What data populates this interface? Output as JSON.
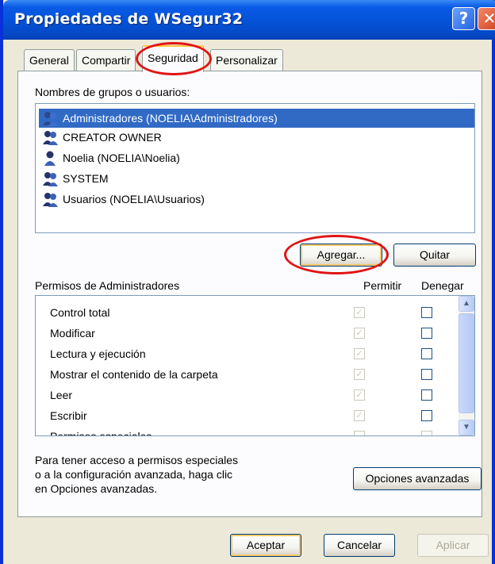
{
  "window": {
    "title": "Propiedades de WSegur32",
    "help_glyph": "?",
    "close_glyph": "✕"
  },
  "tabs": [
    {
      "label": "General"
    },
    {
      "label": "Compartir"
    },
    {
      "label": "Seguridad",
      "active": true
    },
    {
      "label": "Personalizar"
    }
  ],
  "security": {
    "groups_label": "Nombres de grupos o usuarios:",
    "users": [
      {
        "name": "Administradores (NOELIA\\Administradores)",
        "selected": true,
        "icon": "group-icon"
      },
      {
        "name": "CREATOR OWNER",
        "icon": "group-icon"
      },
      {
        "name": "Noelia (NOELIA\\Noelia)",
        "icon": "user-icon"
      },
      {
        "name": "SYSTEM",
        "icon": "group-icon"
      },
      {
        "name": "Usuarios (NOELIA\\Usuarios)",
        "icon": "group-icon"
      }
    ],
    "add_button": "Agregar...",
    "remove_button": "Quitar",
    "permissions_label": "Permisos de Administradores",
    "allow_header": "Permitir",
    "deny_header": "Denegar",
    "permissions": [
      {
        "name": "Control total",
        "allow": true,
        "deny": false
      },
      {
        "name": "Modificar",
        "allow": true,
        "deny": false
      },
      {
        "name": "Lectura y ejecución",
        "allow": true,
        "deny": false
      },
      {
        "name": "Mostrar el contenido de la carpeta",
        "allow": true,
        "deny": false
      },
      {
        "name": "Leer",
        "allow": true,
        "deny": false
      },
      {
        "name": "Escribir",
        "allow": true,
        "deny": false
      },
      {
        "name": "Permisos especiales",
        "allow": false,
        "deny": false
      }
    ],
    "help_lines": [
      "Para tener acceso a permisos especiales",
      "o a la configuración avanzada, haga clic",
      "en Opciones avanzadas."
    ],
    "advanced_button": "Opciones avanzadas"
  },
  "footer": {
    "ok": "Aceptar",
    "cancel": "Cancelar",
    "apply": "Aplicar"
  },
  "colors": {
    "selection": "#316ac5",
    "annotation": "#e01515",
    "titlebar": "#0553d9"
  }
}
